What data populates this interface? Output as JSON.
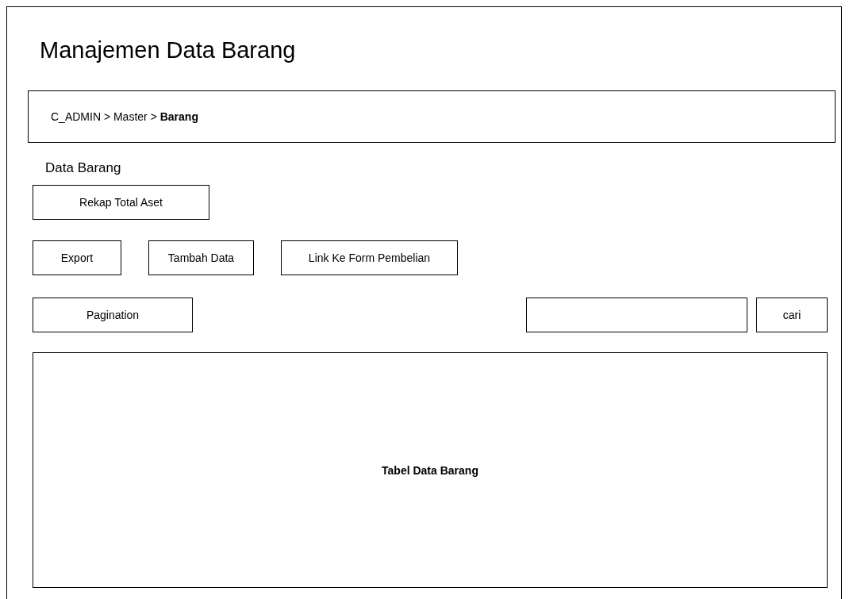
{
  "page_title": "Manajemen Data Barang",
  "breadcrumb": "C_ADMIN > Master > **Barang**",
  "section_title": "Data Barang",
  "summary_button": "Rekap Total Aset",
  "action_buttons": [
    "Export",
    "Tambah Data",
    "Link Ke Form Pembelian"
  ],
  "pagination": "Pagination",
  "search": {
    "button": "cari"
  },
  "table": {
    "label": "Tabel Data Barang"
  }
}
